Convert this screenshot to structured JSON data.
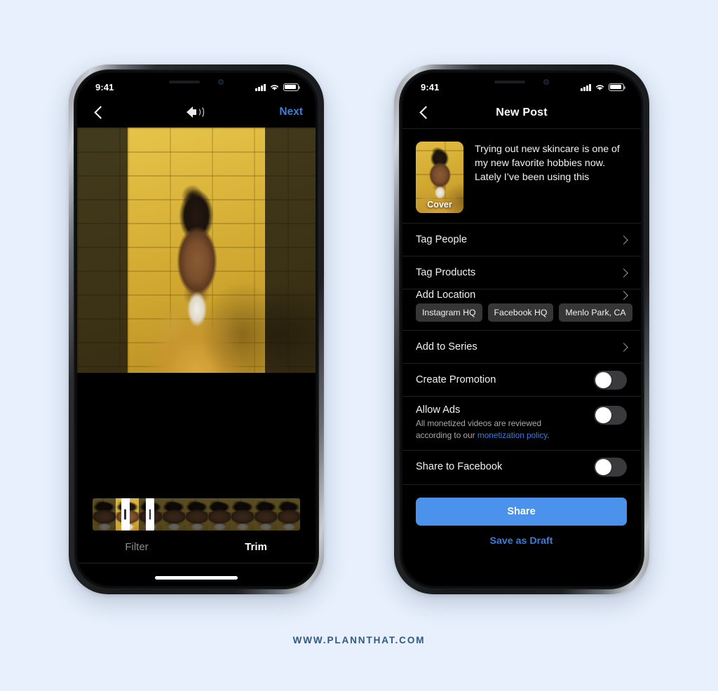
{
  "background_color": "#e7f0fc",
  "accent_blue": "#3a7ddc",
  "share_button_blue": "#4a92ec",
  "footer": {
    "text": "WWW.PLANNTHAT.COM"
  },
  "phone_left": {
    "status_bar": {
      "time": "9:41",
      "signal_icon": "cellular-bars-icon",
      "wifi_icon": "wifi-icon",
      "battery_icon": "battery-icon"
    },
    "nav": {
      "back_icon": "chevron-left-icon",
      "audio_icon": "speaker-volume-icon",
      "next_label": "Next"
    },
    "editor": {
      "trim_scrubber_name": "trim-scrubber",
      "frame_count": 9,
      "selected_frame_index": 1
    },
    "tabs": [
      {
        "label": "Filter",
        "active": false
      },
      {
        "label": "Trim",
        "active": true
      }
    ]
  },
  "phone_right": {
    "status_bar": {
      "time": "9:41",
      "signal_icon": "cellular-bars-icon",
      "wifi_icon": "wifi-icon",
      "battery_icon": "battery-icon"
    },
    "nav": {
      "back_icon": "chevron-left-icon",
      "title": "New Post"
    },
    "composer": {
      "cover_label": "Cover",
      "caption": "Trying out new skincare is one of my new favorite hobbies now. Lately I’ve been using this"
    },
    "rows": [
      {
        "label": "Tag People",
        "type": "chevron"
      },
      {
        "label": "Tag Products",
        "type": "chevron"
      },
      {
        "label": "Add Location",
        "type": "chevron"
      },
      {
        "label": "Add to Series",
        "type": "chevron"
      }
    ],
    "location_chips": [
      "Instagram HQ",
      "Facebook HQ",
      "Menlo Park, CA"
    ],
    "toggles": [
      {
        "label": "Create Promotion",
        "on": false
      },
      {
        "label": "Allow Ads",
        "on": false
      },
      {
        "label": "Share to Facebook",
        "on": false
      }
    ],
    "allow_ads_sub": {
      "line1": "All monetized videos are reviewed",
      "line2_prefix": "according to our ",
      "link": "monetization policy",
      "line2_suffix": "."
    },
    "buttons": {
      "share": "Share",
      "save_draft": "Save as Draft"
    }
  }
}
